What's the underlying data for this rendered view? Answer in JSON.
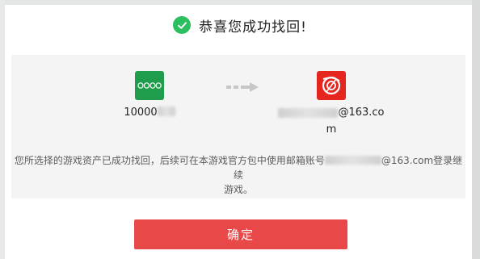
{
  "dialog": {
    "title": "恭喜您成功找回!",
    "check_icon": "check-circle-icon",
    "source_account": {
      "app_icon": "oppo-logo-icon",
      "id_prefix": "10000"
    },
    "transfer_icon": "transfer-arrow-icon",
    "target_account": {
      "app_icon": "netease-logo-icon",
      "email_suffix_line1": "@163.co",
      "email_suffix_line2": "m"
    },
    "description_part1": "您所选择的游戏资产已成功找回，后续可在本游戏官方包中使用邮箱账号",
    "description_part2": "@163.com登录继续",
    "description_part3": "游戏。",
    "confirm_label": "确定"
  },
  "colors": {
    "success_green": "#2dbe60",
    "oppo_green": "#1f9d4c",
    "netease_red": "#e5261f",
    "button_red": "#e84948"
  }
}
